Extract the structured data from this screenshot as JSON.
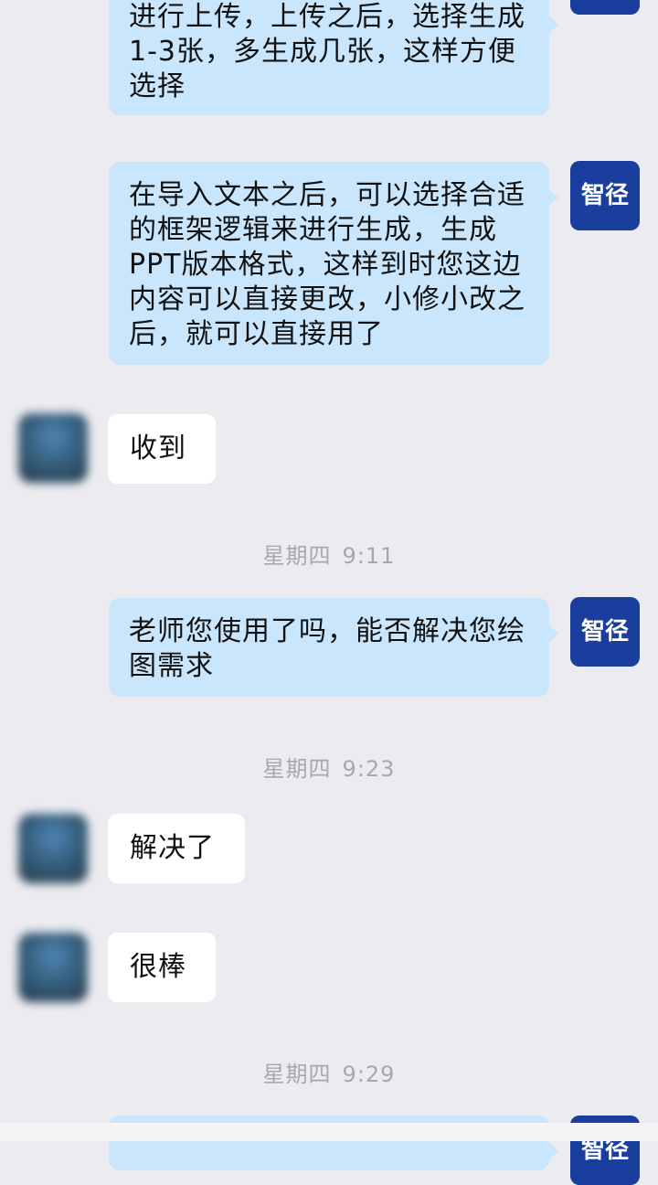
{
  "conversation": {
    "agent_name": "智径",
    "messages": [
      {
        "type": "out",
        "text": "进行上传，上传之后，选择生成1-3张，多生成几张，这样方便选择"
      },
      {
        "type": "out",
        "text": "在导入文本之后，可以选择合适的框架逻辑来进行生成，生成PPT版本格式，这样到时您这边内容可以直接更改，小修小改之后，就可以直接用了"
      },
      {
        "type": "in",
        "text": "收到"
      },
      {
        "type": "time",
        "day": "星期四",
        "time": "9:11"
      },
      {
        "type": "out",
        "text": "老师您使用了吗，能否解决您绘图需求"
      },
      {
        "type": "time",
        "day": "星期四",
        "time": "9:23"
      },
      {
        "type": "in",
        "text": "解决了"
      },
      {
        "type": "in",
        "text": "很棒"
      },
      {
        "type": "time",
        "day": "星期四",
        "time": "9:29"
      },
      {
        "type": "out",
        "text": ""
      }
    ]
  },
  "colors": {
    "background": "#ececf0",
    "outgoing_bubble": "#c9e6fc",
    "incoming_bubble": "#ffffff",
    "agent_avatar": "#1a3e9e",
    "timestamp_text": "#a7a7ad"
  }
}
